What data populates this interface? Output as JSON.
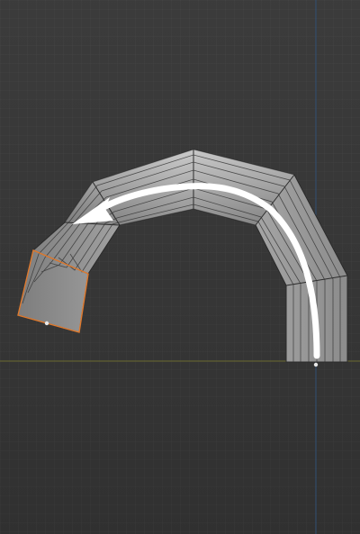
{
  "viewport": {
    "background_color": "#3d3d3d",
    "x_axis_color": "#6b6a2f",
    "y_axis_color": "#2f4e72",
    "selection_color": "#e07a2e",
    "mesh_color": "#b5b5b5",
    "wire_color": "#262626",
    "arrow_color": "#ffffff"
  },
  "object": {
    "name": "",
    "type": "bent-tube-mesh"
  }
}
